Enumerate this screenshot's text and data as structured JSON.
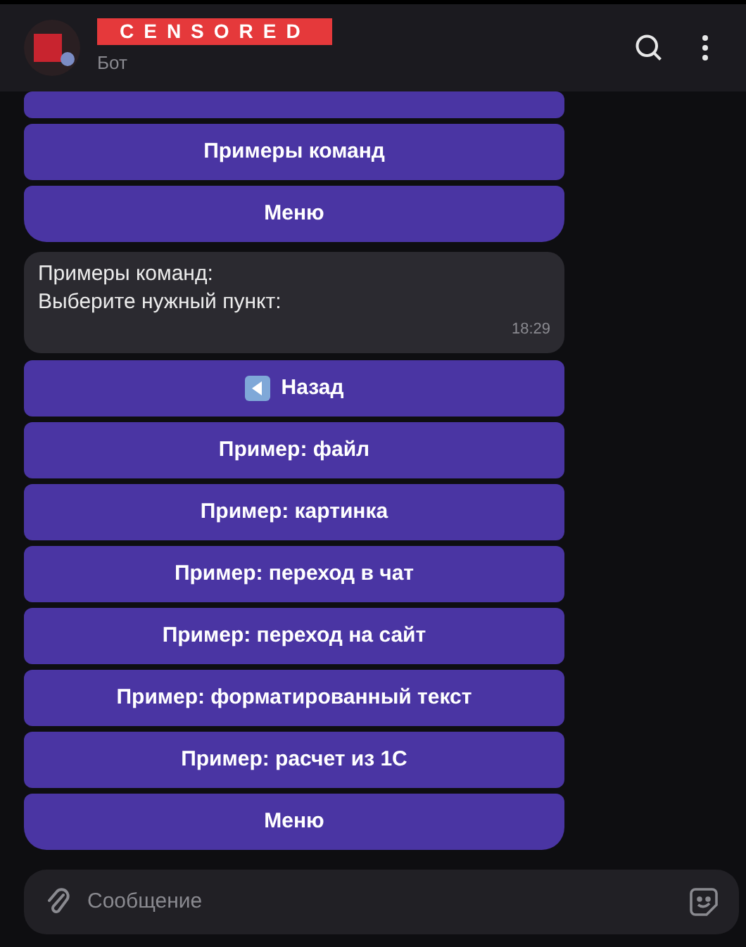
{
  "header": {
    "title": "CENSORED",
    "subtitle": "Бот"
  },
  "keyboard_top": [
    {
      "kind": "cut"
    },
    {
      "label": "Примеры команд"
    },
    {
      "label": "Меню"
    }
  ],
  "message": {
    "lines": [
      "Примеры команд:",
      "Выберите нужный пункт:"
    ],
    "time": "18:29"
  },
  "keyboard": [
    {
      "label": "Назад",
      "kind": "back"
    },
    {
      "label": "Пример: файл",
      "kind": "plain"
    },
    {
      "label": "Пример: картинка",
      "kind": "plain"
    },
    {
      "label": "Пример: переход в чат",
      "kind": "plain"
    },
    {
      "label": "Пример: переход на сайт",
      "kind": "plain"
    },
    {
      "label": "Пример: форматированный текст",
      "kind": "plain"
    },
    {
      "label": "Пример: расчет из 1С",
      "kind": "plain"
    },
    {
      "label": "Меню",
      "kind": "plain"
    }
  ],
  "composer": {
    "placeholder": "Сообщение"
  }
}
